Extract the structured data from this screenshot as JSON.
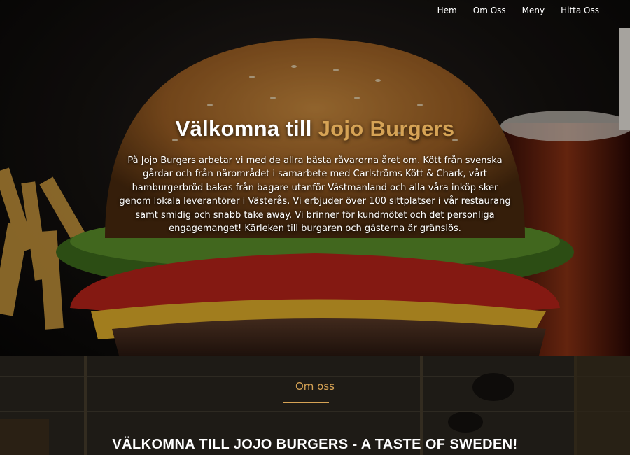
{
  "nav": {
    "items": [
      "Hem",
      "Om Oss",
      "Meny",
      "Hitta Oss"
    ]
  },
  "hero": {
    "title_prefix": "Välkomna till ",
    "title_brand": "Jojo Burgers",
    "description": "På Jojo Burgers arbetar vi med de allra bästa råvarorna året om. Kött från svenska gårdar och från närområdet i samarbete med Carlströms Kött & Chark, vårt hamburgerbröd bakas från bagare utanför Västmanland och alla våra inköp sker genom lokala leverantörer i Västerås. Vi erbjuder över 100 sittplatser i vår restaurang samt smidig och snabb take away. Vi brinner för kundmötet och det personliga engagemanget! Kärleken till burgaren och gästerna är gränslös."
  },
  "about": {
    "label": "Om oss",
    "heading": "VÄLKOMNA TILL JOJO BURGERS - A TASTE OF SWEDEN!"
  },
  "colors": {
    "accent": "#d6a355",
    "text": "#ffffff"
  }
}
